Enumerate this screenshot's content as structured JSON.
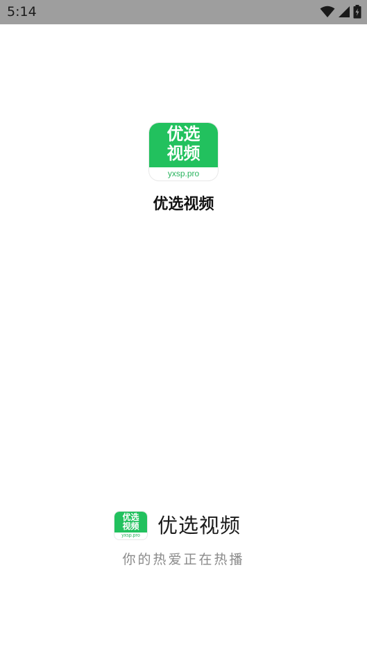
{
  "status_bar": {
    "time": "5:14",
    "icons": [
      "wifi-icon",
      "cell-signal-icon",
      "battery-charging-icon"
    ],
    "background": "#9e9e9e"
  },
  "splash": {
    "icon": {
      "line1": "优选",
      "line2": "视频",
      "domain": "yxsp.pro",
      "color": "#22c15e"
    },
    "app_name": "优选视频"
  },
  "brand": {
    "logo": {
      "line1": "优选",
      "line2": "视频",
      "domain": "yxsp.pro"
    },
    "name": "优选视频",
    "slogan": "你的热爱正在热播"
  }
}
